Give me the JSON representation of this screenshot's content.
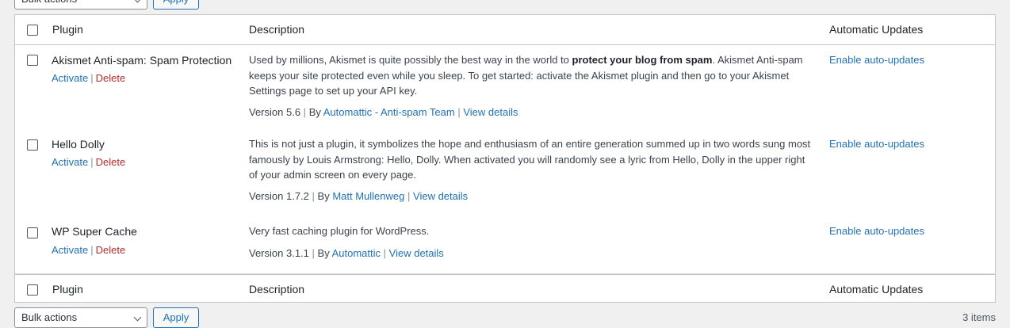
{
  "bulk_actions": {
    "select_label": "Bulk actions",
    "apply_label": "Apply"
  },
  "items_count": "3 items",
  "columns": {
    "plugin": "Plugin",
    "description": "Description",
    "auto_updates": "Automatic Updates"
  },
  "plugins": [
    {
      "name": "Akismet Anti-spam: Spam Protection",
      "activate": "Activate",
      "delete": "Delete",
      "description_pre": "Used by millions, Akismet is quite possibly the best way in the world to ",
      "description_bold": "protect your blog from spam",
      "description_post": ". Akismet Anti-spam keeps your site protected even while you sleep. To get started: activate the Akismet plugin and then go to your Akismet Settings page to set up your API key.",
      "version": "Version 5.6",
      "by": "By",
      "author": "Automattic - Anti-spam Team",
      "view_details": "View details",
      "auto_updates": "Enable auto-updates"
    },
    {
      "name": "Hello Dolly",
      "activate": "Activate",
      "delete": "Delete",
      "description": "This is not just a plugin, it symbolizes the hope and enthusiasm of an entire generation summed up in two words sung most famously by Louis Armstrong: Hello, Dolly. When activated you will randomly see a lyric from Hello, Dolly in the upper right of your admin screen on every page.",
      "version": "Version 1.7.2",
      "by": "By",
      "author": "Matt Mullenweg",
      "view_details": "View details",
      "auto_updates": "Enable auto-updates"
    },
    {
      "name": "WP Super Cache",
      "activate": "Activate",
      "delete": "Delete",
      "description": "Very fast caching plugin for WordPress.",
      "version": "Version 3.1.1",
      "by": "By",
      "author": "Automattic",
      "view_details": "View details",
      "auto_updates": "Enable auto-updates"
    }
  ],
  "separators": {
    "pipe": "|"
  }
}
